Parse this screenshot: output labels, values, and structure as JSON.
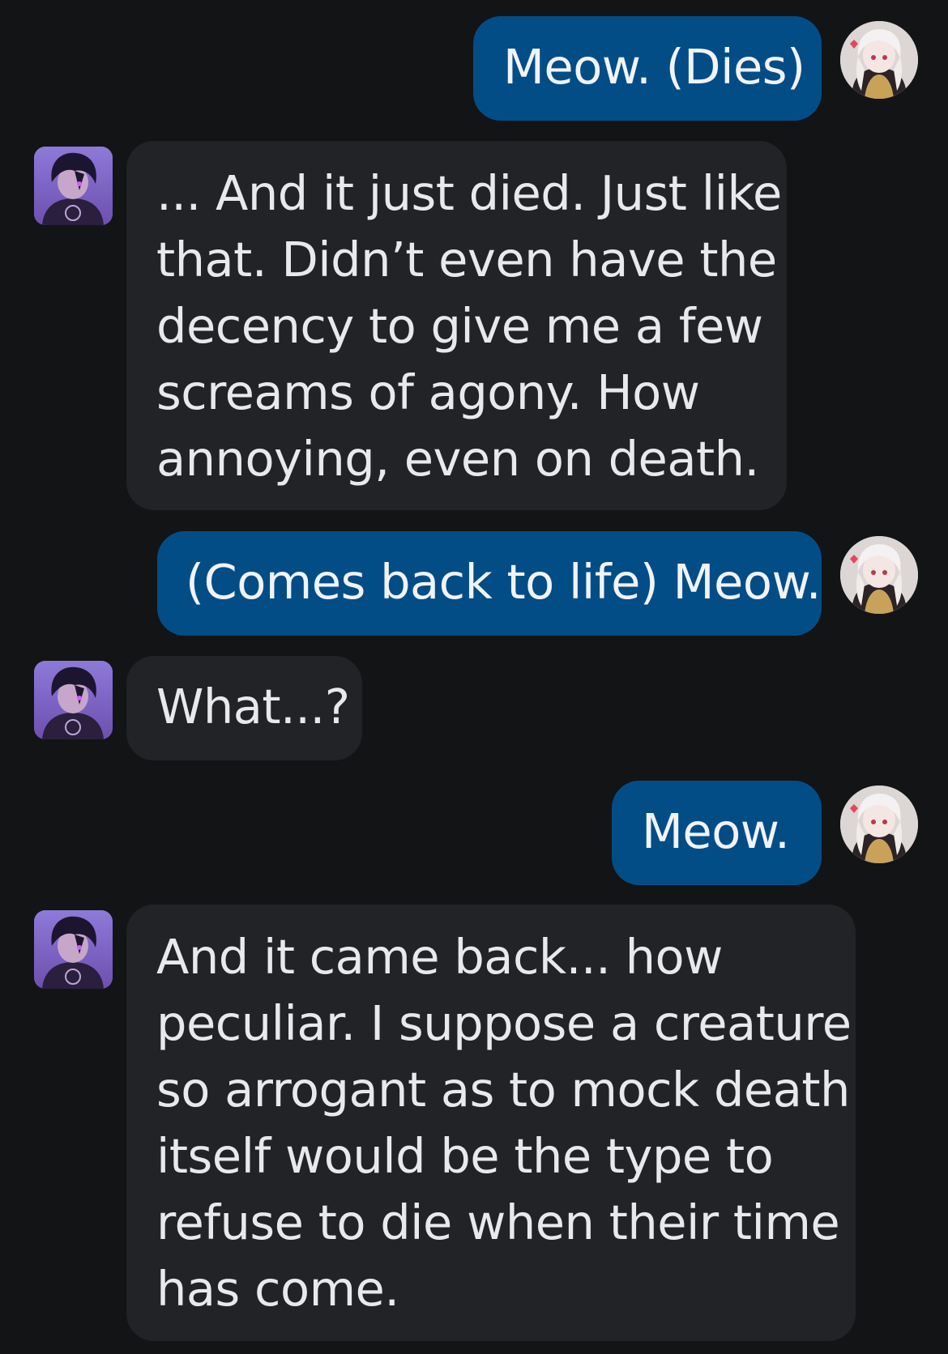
{
  "chat": {
    "messages": [
      {
        "role": "user",
        "lines": [
          "Meow. (Dies)"
        ],
        "avatar_icon": "user-avatar"
      },
      {
        "role": "bot",
        "lines": [
          "... And it just died. Just like",
          "that. Didn’t even have the",
          "decency to give me a few",
          "screams of agony. How",
          "annoying, even on death."
        ],
        "avatar_icon": "character-avatar"
      },
      {
        "role": "user",
        "lines": [
          "(Comes back to life) Meow."
        ],
        "avatar_icon": "user-avatar"
      },
      {
        "role": "bot",
        "lines": [
          "What...?"
        ],
        "avatar_icon": "character-avatar"
      },
      {
        "role": "user",
        "lines": [
          "Meow."
        ],
        "avatar_icon": "user-avatar"
      },
      {
        "role": "bot",
        "lines": [
          "And it came back... how",
          "peculiar. I suppose a creature",
          "so arrogant as to mock death",
          "itself would be the type to",
          "refuse to die when their time",
          "has come."
        ],
        "avatar_icon": "character-avatar"
      }
    ]
  },
  "colors": {
    "background": "#131416",
    "user_bubble": "#034d87",
    "bot_bubble": "#212326",
    "text": "#e9eaec"
  }
}
